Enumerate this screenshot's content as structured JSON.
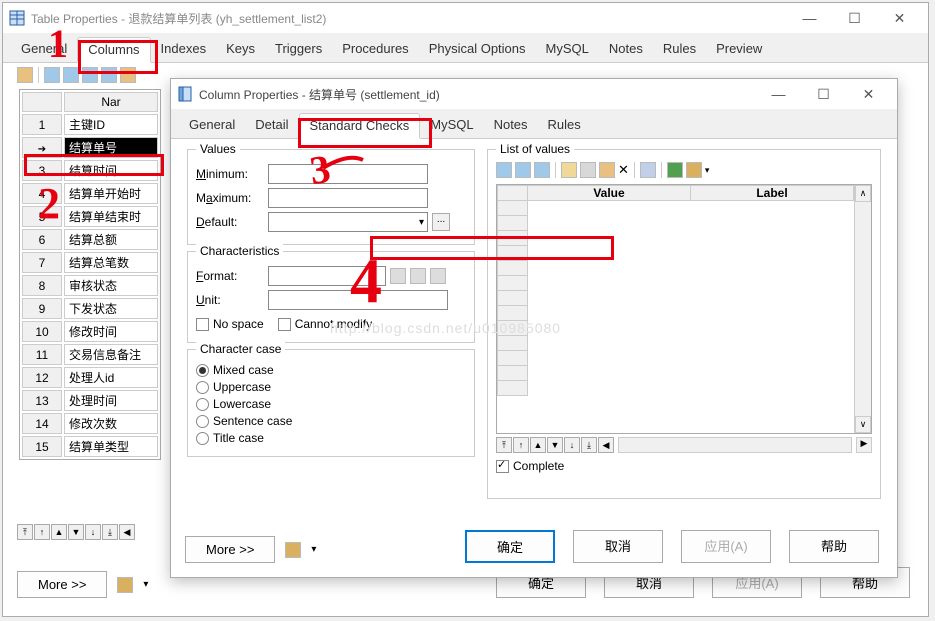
{
  "main_window": {
    "title": "Table Properties - 退款结算单列表 (yh_settlement_list2)",
    "tabs": [
      "General",
      "Columns",
      "Indexes",
      "Keys",
      "Triggers",
      "Procedures",
      "Physical Options",
      "MySQL",
      "Notes",
      "Rules",
      "Preview"
    ],
    "header_name": "Nar",
    "rows": [
      {
        "n": "1",
        "name": "主键ID"
      },
      {
        "n": "",
        "name": "结算单号",
        "sel": true,
        "arrow": "➔"
      },
      {
        "n": "3",
        "name": "结算时间"
      },
      {
        "n": "4",
        "name": "结算单开始时"
      },
      {
        "n": "5",
        "name": "结算单结束时"
      },
      {
        "n": "6",
        "name": "结算总额"
      },
      {
        "n": "7",
        "name": "结算总笔数"
      },
      {
        "n": "8",
        "name": "审核状态"
      },
      {
        "n": "9",
        "name": "下发状态"
      },
      {
        "n": "10",
        "name": "修改时间"
      },
      {
        "n": "11",
        "name": "交易信息备注"
      },
      {
        "n": "12",
        "name": "处理人id"
      },
      {
        "n": "13",
        "name": "处理时间"
      },
      {
        "n": "14",
        "name": "修改次数"
      },
      {
        "n": "15",
        "name": "结算单类型"
      }
    ],
    "buttons": {
      "more": "More >>",
      "ok": "确定",
      "cancel": "取消",
      "apply": "应用(A)",
      "help": "帮助"
    }
  },
  "column_window": {
    "title": "Column Properties - 结算单号 (settlement_id)",
    "tabs": [
      "General",
      "Detail",
      "Standard Checks",
      "MySQL",
      "Notes",
      "Rules"
    ],
    "values": {
      "legend": "Values",
      "min": "Minimum:",
      "max": "Maximum:",
      "default": "Default:"
    },
    "characteristics": {
      "legend": "Characteristics",
      "format": "Format:",
      "unit": "Unit:",
      "nospace": "No space",
      "cannotmod": "Cannot modify"
    },
    "charcase": {
      "legend": "Character case",
      "opts": [
        "Mixed case",
        "Uppercase",
        "Lowercase",
        "Sentence case",
        "Title case"
      ]
    },
    "listofvalues": {
      "legend": "List of values",
      "cols": {
        "value": "Value",
        "label": "Label"
      },
      "complete": "Complete"
    },
    "buttons": {
      "more": "More >>",
      "ok": "确定",
      "cancel": "取消",
      "apply": "应用(A)",
      "help": "帮助"
    }
  },
  "annotations": {
    "a1": "1",
    "a2": "2",
    "a3": "3",
    "a4": "4"
  },
  "watermark": "http://blog.csdn.net/u010985080"
}
